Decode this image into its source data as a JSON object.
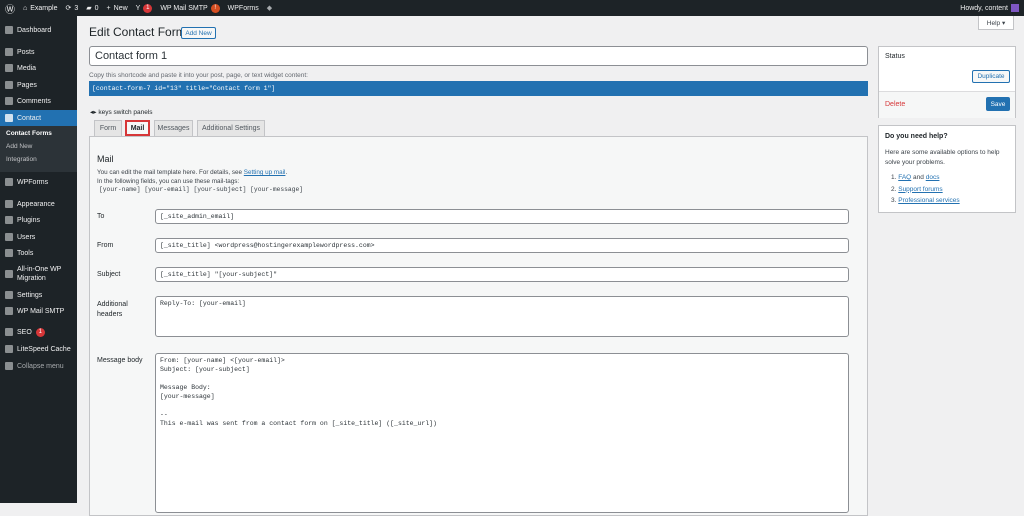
{
  "adminbar": {
    "site": "Example",
    "updates": "3",
    "comments": "0",
    "new": "New",
    "yoast_badge": "1",
    "smtp": "WP Mail SMTP",
    "smtp_badge": "!",
    "wpforms": "WPForms",
    "howdy": "Howdy, content"
  },
  "sidebar": {
    "items": [
      {
        "label": "Dashboard",
        "icon": "dashboard-icon"
      },
      {
        "label": "Posts",
        "icon": "pin-icon"
      },
      {
        "label": "Media",
        "icon": "media-icon"
      },
      {
        "label": "Pages",
        "icon": "pages-icon"
      },
      {
        "label": "Comments",
        "icon": "comment-icon"
      },
      {
        "label": "Contact",
        "icon": "mail-icon"
      },
      {
        "label": "WPForms",
        "icon": "wpforms-icon"
      },
      {
        "label": "Appearance",
        "icon": "brush-icon"
      },
      {
        "label": "Plugins",
        "icon": "plugin-icon"
      },
      {
        "label": "Users",
        "icon": "user-icon"
      },
      {
        "label": "Tools",
        "icon": "wrench-icon"
      },
      {
        "label": "All-in-One WP Migration",
        "icon": "migration-icon"
      },
      {
        "label": "Settings",
        "icon": "settings-icon"
      },
      {
        "label": "WP Mail SMTP",
        "icon": "mail-smtp-icon"
      },
      {
        "label": "SEO",
        "icon": "yoast-icon",
        "badge": "1"
      },
      {
        "label": "LiteSpeed Cache",
        "icon": "litespeed-icon"
      },
      {
        "label": "Collapse menu",
        "icon": "collapse-icon"
      }
    ],
    "submenu": [
      "Contact Forms",
      "Add New",
      "Integration"
    ]
  },
  "header": {
    "title": "Edit Contact Form",
    "add_new": "Add New",
    "help": "Help ▾"
  },
  "form": {
    "title_value": "Contact form 1",
    "shortcode_hint": "Copy this shortcode and paste it into your post, page, or text widget content:",
    "shortcode": "[contact-form-7 id=\"13\" title=\"Contact form 1\"]",
    "keys_hint": "keys switch panels"
  },
  "tabs": [
    "Form",
    "Mail",
    "Messages",
    "Additional Settings"
  ],
  "active_tab": "Mail",
  "mail": {
    "heading": "Mail",
    "desc1": "You can edit the mail template here. For details, see ",
    "desc_link": "Setting up mail",
    "desc1_end": ".",
    "desc2": "In the following fields, you can use these mail-tags:",
    "tags": "[your-name] [your-email] [your-subject] [your-message]",
    "to_label": "To",
    "to": "[_site_admin_email]",
    "from_label": "From",
    "from": "[_site_title] <wordpress@hostingerexamplewordpress.com>",
    "subject_label": "Subject",
    "subject": "[_site_title] \"[your-subject]\"",
    "headers_label": "Additional headers",
    "headers": "Reply-To: [your-email]",
    "body_label": "Message body",
    "body": "From: [your-name] <[your-email]>\nSubject: [your-subject]\n\nMessage Body:\n[your-message]\n\n-- \nThis e-mail was sent from a contact form on [_site_title] ([_site_url])"
  },
  "status": {
    "title": "Status",
    "duplicate": "Duplicate",
    "delete": "Delete",
    "save": "Save"
  },
  "help": {
    "title": "Do you need help?",
    "text": "Here are some available options to help solve your problems.",
    "faq": "FAQ",
    "and": " and ",
    "docs": "docs",
    "forums": "Support forums",
    "pro": "Professional services"
  },
  "colors": {
    "accent": "#2271b1",
    "sidebar": "#1d2327",
    "highlight": "#d63638"
  }
}
